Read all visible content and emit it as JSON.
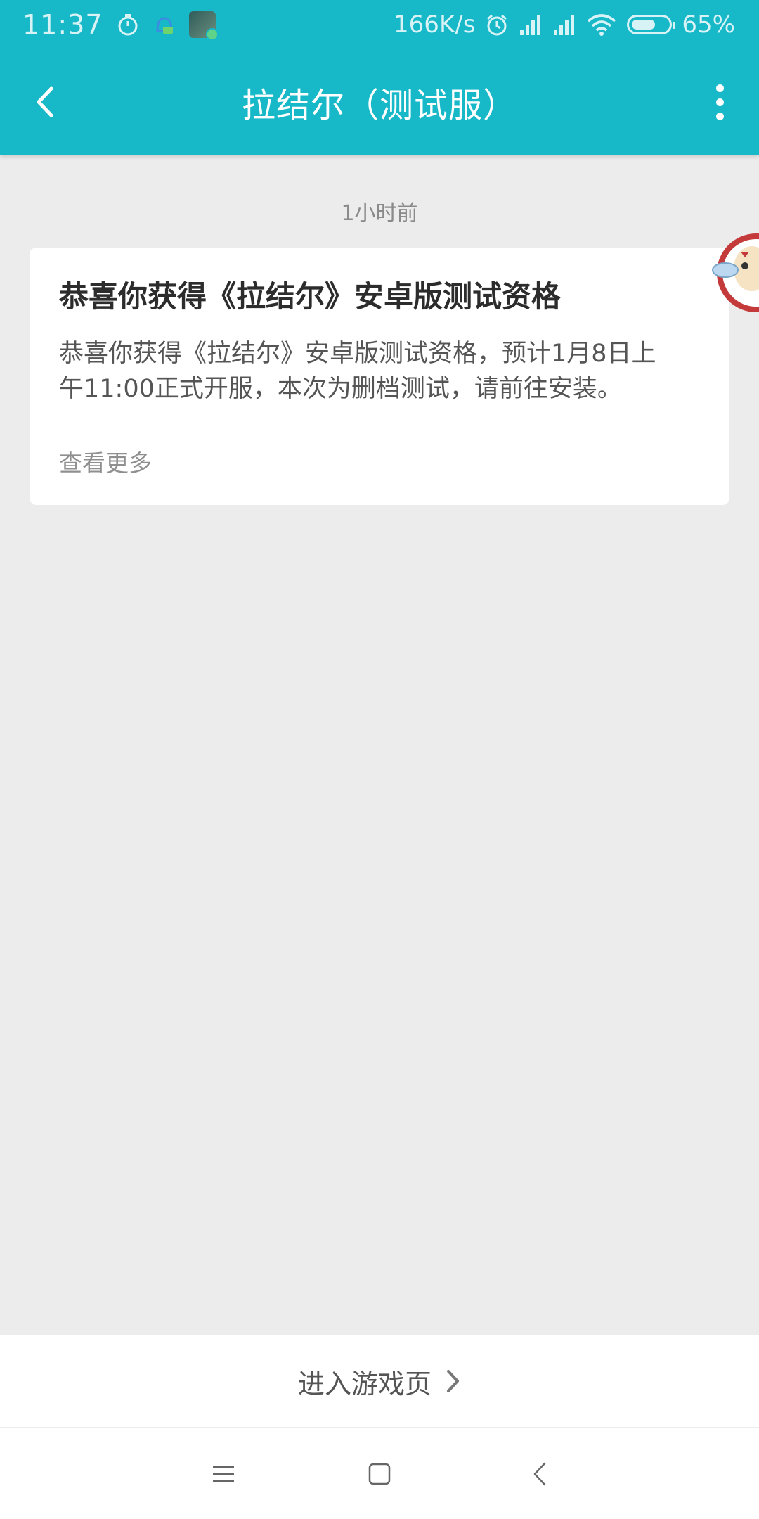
{
  "status_bar": {
    "time": "11:37",
    "net_speed": "166K/s",
    "battery_percent": "65%",
    "battery_level": 0.65,
    "icons": [
      "stopwatch-icon",
      "notification-app-icon",
      "app-thumbnail-icon",
      "alarm-icon",
      "signal-icon",
      "signal-icon",
      "wifi-icon",
      "battery-icon"
    ]
  },
  "app_bar": {
    "title": "拉结尔（测试服）",
    "back_icon": "chevron-left-icon",
    "menu_icon": "more-vertical-icon"
  },
  "message": {
    "timestamp": "1小时前",
    "title": "恭喜你获得《拉结尔》安卓版测试资格",
    "body": "恭喜你获得《拉结尔》安卓版测试资格，预计1月8日上午11:00正式开服，本次为删档测试，请前往安装。",
    "more_label": "查看更多"
  },
  "footer": {
    "enter_game_label": "进入游戏页"
  },
  "nav_bar": {
    "icons": [
      "menu-icon",
      "home-square-icon",
      "back-chevron-icon"
    ]
  },
  "colors": {
    "primary": "#17b8c8",
    "background": "#ececec",
    "card": "#ffffff"
  }
}
